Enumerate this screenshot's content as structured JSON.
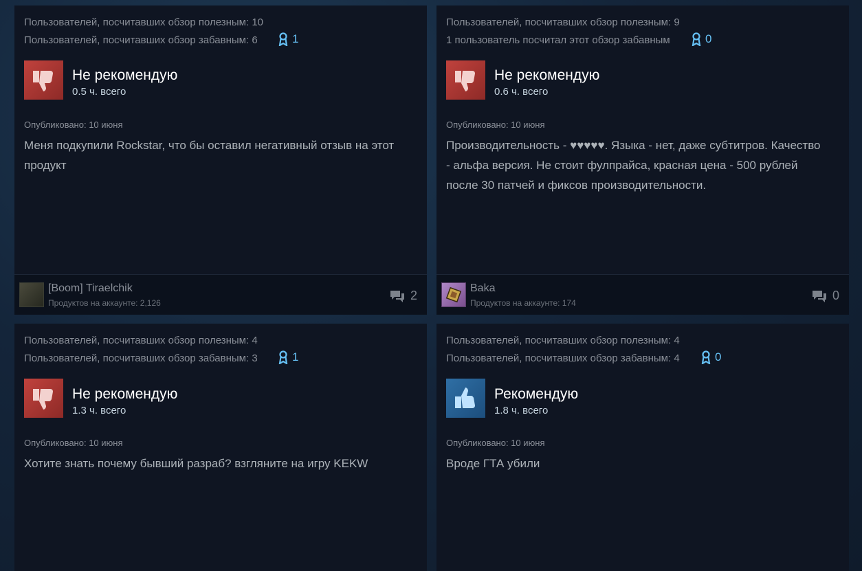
{
  "reviews": [
    {
      "helpful": "Пользователей, посчитавших обзор полезным: 10",
      "funny": "Пользователей, посчитавших обзор забавным: 6",
      "awards": "1",
      "verdict": "Не рекомендую",
      "verdict_icon": "thumbs-down-icon",
      "hours": "0.5 ч. всего",
      "posted": "Опубликовано: 10 июня",
      "text": "Меня подкупили Rockstar, что бы оставил негативный отзыв на этот продукт",
      "author": "[Boom] Tiraelchik",
      "products": "Продуктов на аккаунте: 2,126",
      "comments": "2"
    },
    {
      "helpful": "Пользователей, посчитавших обзор полезным: 9",
      "funny": "1 пользователь посчитал этот обзор забавным",
      "awards": "0",
      "verdict": "Не рекомендую",
      "verdict_icon": "thumbs-down-icon",
      "hours": "0.6 ч. всего",
      "posted": "Опубликовано: 10 июня",
      "text": "Производительность - ♥♥♥♥♥. Языка - нет, даже субтитров. Качество - альфа версия. Не стоит фулпрайса, красная цена - 500 рублей после 30 патчей и фиксов производительности.",
      "author": "Baka",
      "products": "Продуктов на аккаунте: 174",
      "comments": "0"
    },
    {
      "helpful": "Пользователей, посчитавших обзор полезным: 4",
      "funny": "Пользователей, посчитавших обзор забавным: 3",
      "awards": "1",
      "verdict": "Не рекомендую",
      "verdict_icon": "thumbs-down-icon",
      "hours": "1.3 ч. всего",
      "posted": "Опубликовано: 10 июня",
      "text": "Хотите знать почему бывший разраб? взгляните на игру KEKW"
    },
    {
      "helpful": "Пользователей, посчитавших обзор полезным: 4",
      "funny": "Пользователей, посчитавших обзор забавным: 4",
      "awards": "0",
      "verdict": "Рекомендую",
      "verdict_icon": "thumbs-up-icon",
      "hours": "1.8 ч. всего",
      "posted": "Опубликовано: 10 июня",
      "text": "Вроде ГТА убили"
    }
  ],
  "colors": {
    "accent": "#66c0f4",
    "negative": "#c0423d",
    "positive": "#2f6fa5",
    "card_bg": "#0f1522"
  }
}
